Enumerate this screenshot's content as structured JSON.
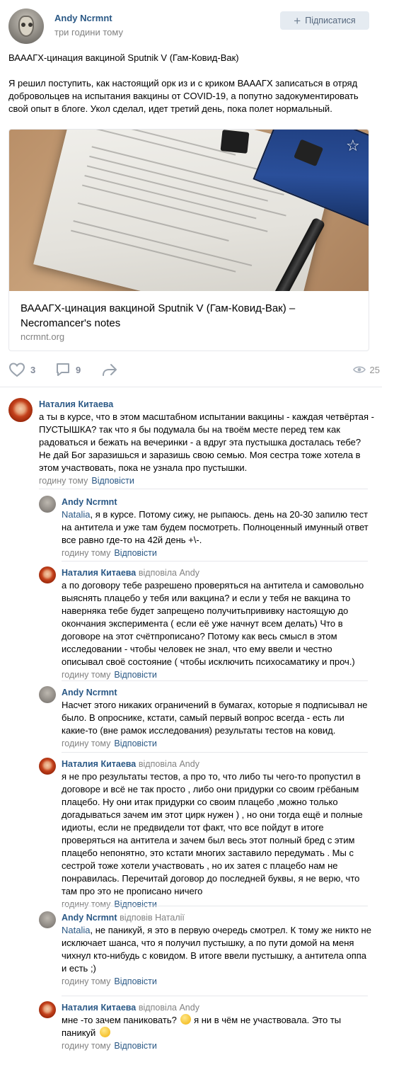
{
  "post": {
    "author": "Andy Ncrmnt",
    "time": "три години тому",
    "subscribe_label": "Підписатися",
    "title_line": "ВАААГХ-цинация вакциной Sputnik V (Гам-Ковид-Вак)",
    "body": "Я решил поступить, как настоящий орк из и с криком ВАААГХ записаться в отряд добровольцев на испытания вакцины от COVID-19, а попутно задокументировать свой опыт в блоге. Укол сделал, идет третий день, пока полет нормальный.",
    "link_card": {
      "title": "ВАААГХ-цинация вакциной Sputnik V (Гам-Ковид-Вак) – Necromancer's notes",
      "domain": "ncrmnt.org"
    },
    "likes": "3",
    "comments": "9",
    "views": "25"
  },
  "comments": [
    {
      "author": "Наталия Китаева",
      "reply_to": "",
      "mention": "",
      "text": "а ты в курсе, что в этом масштабном испытании вакцины - каждая четвёртая - ПУСТЫШКА? так что я бы подумала бы на твоём месте перед тем как радоваться и бежать на вечеринки - а вдруг эта пустышка досталась тебе? Не дай Бог заразишься и заразишь свою семью. Моя сестра тоже хотела в этом участвовать, пока не узнала про пустышки.",
      "time": "годину тому",
      "reply_label": "Відповісти"
    },
    {
      "author": "Andy Ncrmnt",
      "reply_to": "",
      "mention": "Natalia",
      "text": ", я в курсе. Потому сижу, не рыпаюсь. день на 20-30 запилю тест на антитела и уже там будем посмотреть. Полноценный имунный ответ все равно где-то на 42й день +\\-.",
      "time": "годину тому",
      "reply_label": "Відповісти"
    },
    {
      "author": "Наталия Китаева",
      "reply_to": "відповіла Andy",
      "mention": "",
      "text": "а по договору тебе разрешено проверяться на антитела и самовольно выяснять плацебо у тебя или вакцина? и если у тебя не вакцина то наверняка тебе будет запрещено получитьпрививку настоящую до окончания эксперимента ( если её уже начнут всем делать) Что в договоре на этот счётпрописано? Потому как весь смысл в этом исследовании - чтобы человек не знал, что ему ввели и честно описывал своё состояние ( чтобы исключить психосаматику и проч.)",
      "time": "годину тому",
      "reply_label": "Відповісти"
    },
    {
      "author": "Andy Ncrmnt",
      "reply_to": "",
      "mention": "",
      "text": "Насчет этого никаких ограничений в бумагах, которые я подписывал не было. В опроснике, кстати, самый первый вопрос всегда - есть ли какие-то (вне рамок исследования) результаты тестов на ковид.",
      "time": "годину тому",
      "reply_label": "Відповісти"
    },
    {
      "author": "Наталия Китаева",
      "reply_to": "відповіла Andy",
      "mention": "",
      "text": "я не про результаты тестов, а про то, что либо ты чего-то пропустил в договоре и всё не так просто , либо они придурки со своим грёбаным плацебо. Ну они итак придурки со своим плацебо ,можно только догадываться зачем им этот цирк нужен ) , но они тогда ещё и полные идиоты, если не предвидели тот факт, что все пойдут в итоге проверяться на антитела и зачем был весь этот полный бред с этим плацебо непонятно, это кстати многих заставило передумать . Мы с сестрой тоже хотели участвовать , но их затея с плацебо нам не понравилась. Перечитай договор до последней буквы, я не верю, что там про это не прописано ничего",
      "time": "годину тому",
      "reply_label": "Відповісти"
    },
    {
      "author": "Andy Ncrmnt",
      "reply_to": "відповів Наталії",
      "mention": "Natalia",
      "text": ", не паникуй, я это в первую очередь смотрел. К тому же никто не исключает шанса, что я получил пустышку, а по пути домой на меня чихнул кто-нибудь с ковидом. В итоге ввели пустышку, а антитела оппа и есть ;)",
      "time": "годину тому",
      "reply_label": "Відповісти"
    },
    {
      "author": "Наталия Китаева",
      "reply_to": "відповіла Andy",
      "mention": "",
      "text": "мне -то зачем паниковать? ",
      "text2": " я ни в чём не участвовала. Это ты паникуй ",
      "time": "годину тому",
      "reply_label": "Відповісти"
    }
  ]
}
